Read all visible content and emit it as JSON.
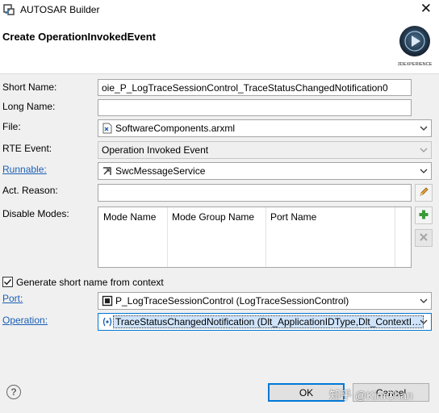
{
  "window": {
    "title": "AUTOSAR Builder",
    "app_icon": "autosar-builder-icon",
    "close_glyph": "✕"
  },
  "header": {
    "title": "Create OperationInvokedEvent",
    "logo_text": "3DEXPERIENCE"
  },
  "form": {
    "short_name": {
      "label": "Short Name:",
      "value": "oie_P_LogTraceSessionControl_TraceStatusChangedNotification0"
    },
    "long_name": {
      "label": "Long Name:",
      "value": ""
    },
    "file": {
      "label": "File:",
      "value": "SoftwareComponents.arxml",
      "icon": "arxml-file-icon"
    },
    "rte_event": {
      "label": "RTE Event:",
      "value": "Operation Invoked Event"
    },
    "runnable": {
      "label": "Runnable:",
      "value": "SwcMessageService",
      "icon": "runnable-icon"
    },
    "act_reason": {
      "label": "Act. Reason:",
      "value": "",
      "edit_icon": "pencil-icon"
    },
    "disable_modes": {
      "label": "Disable Modes:",
      "columns": [
        "Mode Name",
        "Mode Group Name",
        "Port Name"
      ],
      "rows": []
    },
    "generate_short_name": {
      "label": "Generate short name from context",
      "checked": true
    },
    "port": {
      "label": "Port:",
      "value": "P_LogTraceSessionControl (LogTraceSessionControl)",
      "icon": "port-icon"
    },
    "operation": {
      "label": "Operation:",
      "value": "TraceStatusChangedNotification (Dlt_ApplicationIDType,Dlt_ContextI…",
      "icon": "operation-icon"
    }
  },
  "buttons": {
    "ok": "OK",
    "cancel": "Cancel",
    "help": "?"
  },
  "watermark": "知乎 @KimChan",
  "colors": {
    "link": "#1a5fb4",
    "focus_outline": "#0078d7",
    "add_green": "#3a9a3a"
  }
}
